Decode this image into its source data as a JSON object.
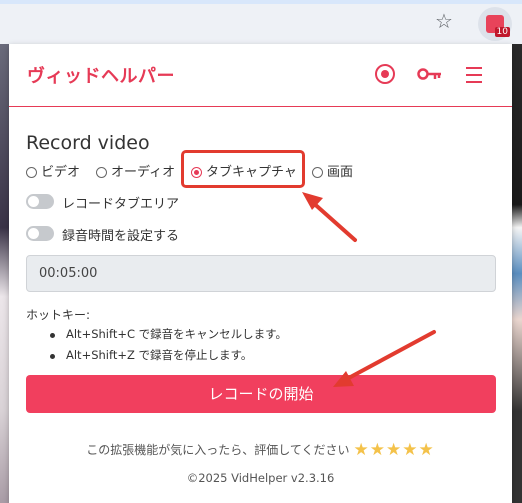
{
  "popup": {
    "app_title": "ヴィッドヘルパー",
    "section_title": "Record video",
    "radios": [
      {
        "label": "ビデオ",
        "checked": false
      },
      {
        "label": "オーディオ",
        "checked": false
      },
      {
        "label": "タブキャプチャ",
        "checked": true
      },
      {
        "label": "画面",
        "checked": false
      }
    ],
    "toggles": [
      {
        "label": "レコードタブエリア"
      },
      {
        "label": "録音時間を設定する"
      }
    ],
    "time_value": "00:05:00",
    "hotkey_title": "ホットキー:",
    "hotkeys": [
      "Alt+Shift+C で録音をキャンセルします。",
      "Alt+Shift+Z で録音を停止します。"
    ],
    "start_button": "レコードの開始",
    "rating_text": "この拡張機能が気に入ったら、評価してください",
    "stars": "★★★★★",
    "footer": "©2025 VidHelper v2.3.16"
  },
  "browser": {
    "extension_badge": "10"
  },
  "colors": {
    "accent": "#e63a56",
    "button": "#f13f5e",
    "annotation": "#e23b2f"
  },
  "icons": [
    "star-icon",
    "extension-icon",
    "record-icon",
    "key-icon",
    "menu-icon"
  ]
}
